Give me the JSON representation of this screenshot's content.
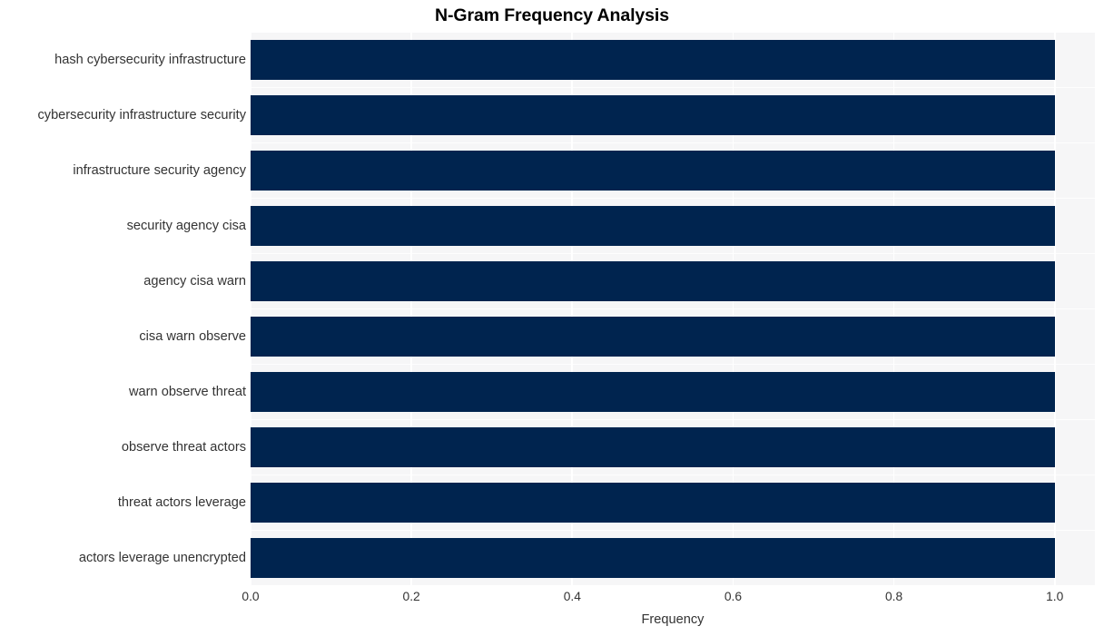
{
  "chart_data": {
    "type": "bar",
    "orientation": "horizontal",
    "title": "N-Gram Frequency Analysis",
    "xlabel": "Frequency",
    "ylabel": "",
    "categories": [
      "hash cybersecurity infrastructure",
      "cybersecurity infrastructure security",
      "infrastructure security agency",
      "security agency cisa",
      "agency cisa warn",
      "cisa warn observe",
      "warn observe threat",
      "observe threat actors",
      "threat actors leverage",
      "actors leverage unencrypted"
    ],
    "values": [
      1.0,
      1.0,
      1.0,
      1.0,
      1.0,
      1.0,
      1.0,
      1.0,
      1.0,
      1.0
    ],
    "xlim": [
      0.0,
      1.05
    ],
    "xticks": [
      "0.0",
      "0.2",
      "0.4",
      "0.6",
      "0.8",
      "1.0"
    ],
    "xtick_values": [
      0.0,
      0.2,
      0.4,
      0.6,
      0.8,
      1.0
    ],
    "grid": true,
    "legend": null,
    "bar_color": "#00244f",
    "plot_background": "#f6f6f7",
    "figure_background": "#ffffff",
    "gridline_color": "#ffffff"
  }
}
